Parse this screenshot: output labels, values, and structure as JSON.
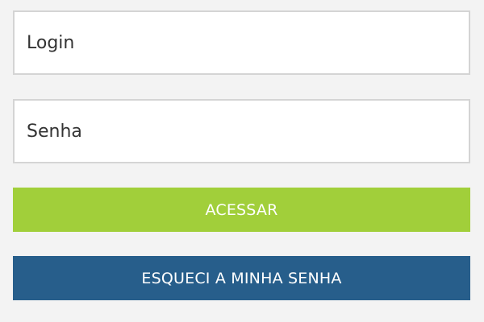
{
  "login": {
    "username_placeholder": "Login",
    "password_placeholder": "Senha",
    "submit_label": "ACESSAR",
    "forgot_label": "ESQUECI A MINHA SENHA"
  },
  "colors": {
    "page_background": "#f3f3f3",
    "field_border": "#d4d4d4",
    "submit_button": "#a1cf3a",
    "forgot_button": "#275e8b",
    "button_text": "#ffffff"
  }
}
